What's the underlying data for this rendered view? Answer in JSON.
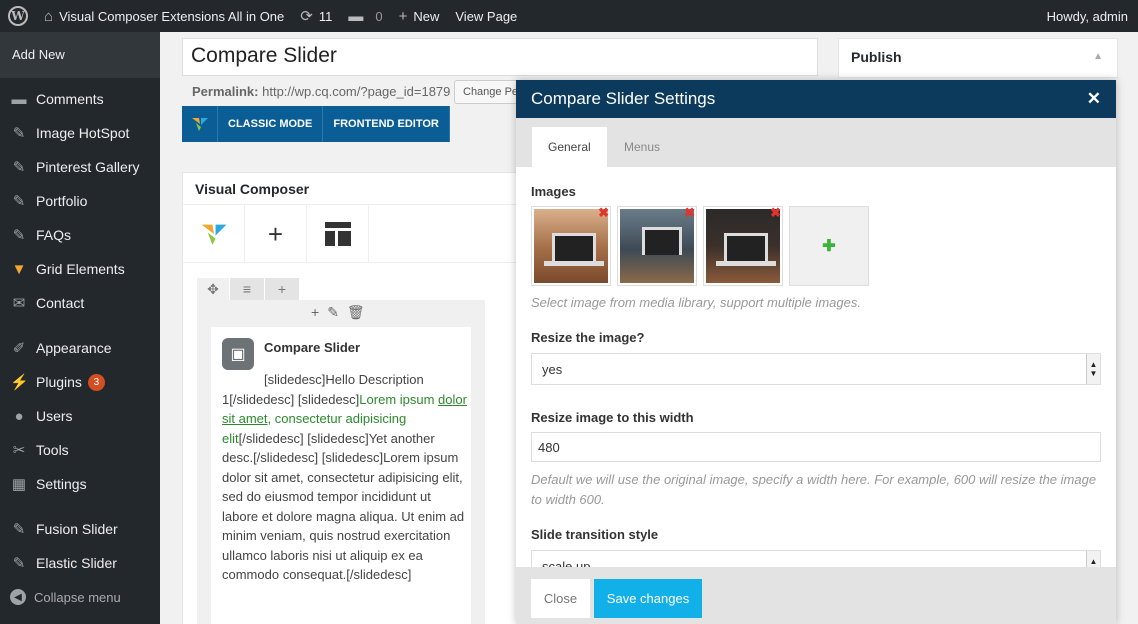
{
  "adminbar": {
    "site_name": "Visual Composer Extensions All in One",
    "updates_count": "11",
    "comments_count": "0",
    "new_label": "New",
    "view_page_label": "View Page",
    "howdy": "Howdy, admin"
  },
  "sidebar": {
    "add_new": "Add New",
    "items": [
      {
        "label": "Comments",
        "icon": "comment-icon"
      },
      {
        "label": "Image HotSpot",
        "icon": "pin-icon"
      },
      {
        "label": "Pinterest Gallery",
        "icon": "pin-icon"
      },
      {
        "label": "Portfolio",
        "icon": "pin-icon"
      },
      {
        "label": "FAQs",
        "icon": "pin-icon"
      },
      {
        "label": "Grid Elements",
        "icon": "vc-logo-icon"
      },
      {
        "label": "Contact",
        "icon": "envelope-icon"
      },
      {
        "label": "Appearance",
        "icon": "brush-icon"
      },
      {
        "label": "Plugins",
        "icon": "plug-icon",
        "badge": "3"
      },
      {
        "label": "Users",
        "icon": "user-icon"
      },
      {
        "label": "Tools",
        "icon": "wrench-icon"
      },
      {
        "label": "Settings",
        "icon": "sliders-icon"
      },
      {
        "label": "Fusion Slider",
        "icon": "pin-icon"
      },
      {
        "label": "Elastic Slider",
        "icon": "pin-icon"
      }
    ],
    "collapse_label": "Collapse menu"
  },
  "editor": {
    "title": "Compare Slider",
    "permalink_label": "Permalink:",
    "permalink_url": "http://wp.cq.com/?page_id=1879",
    "change_permalink": "Change Permalinks",
    "classic_mode": "CLASSIC MODE",
    "frontend_editor": "FRONTEND EDITOR"
  },
  "vc_panel": {
    "title": "Visual Composer",
    "element_title": "Compare Slider",
    "text_part1": "[slidedesc]Hello Description 1[/slidedesc] [slidedesc]",
    "text_green1": "Lorem ipsum ",
    "text_green_link": "dolor sit amet",
    "text_green2": ", consectetur adipisicing elit",
    "text_part2": "[/slidedesc] [slidedesc]Yet another desc.[/slidedesc] [slidedesc]Lorem ipsum dolor sit amet, consectetur adipisicing elit, sed do eiusmod tempor incididunt ut labore et dolore magna aliqua. Ut enim ad minim veniam, quis nostrud exercitation ullamco laboris nisi ut aliquip ex ea commodo consequat.[/slidedesc]"
  },
  "publish": {
    "title": "Publish"
  },
  "modal": {
    "title": "Compare Slider Settings",
    "tabs": [
      "General",
      "Menus"
    ],
    "images_label": "Images",
    "images_help": "Select image from media library, support multiple images.",
    "resize_label": "Resize the image?",
    "resize_value": "yes",
    "width_label": "Resize image to this width",
    "width_value": "480",
    "width_help": "Default we will use the original image, specify a width here. For example, 600 will resize the image to width 600.",
    "transition_label": "Slide transition style",
    "transition_value": "scale up",
    "close_button": "Close",
    "save_button": "Save changes"
  }
}
